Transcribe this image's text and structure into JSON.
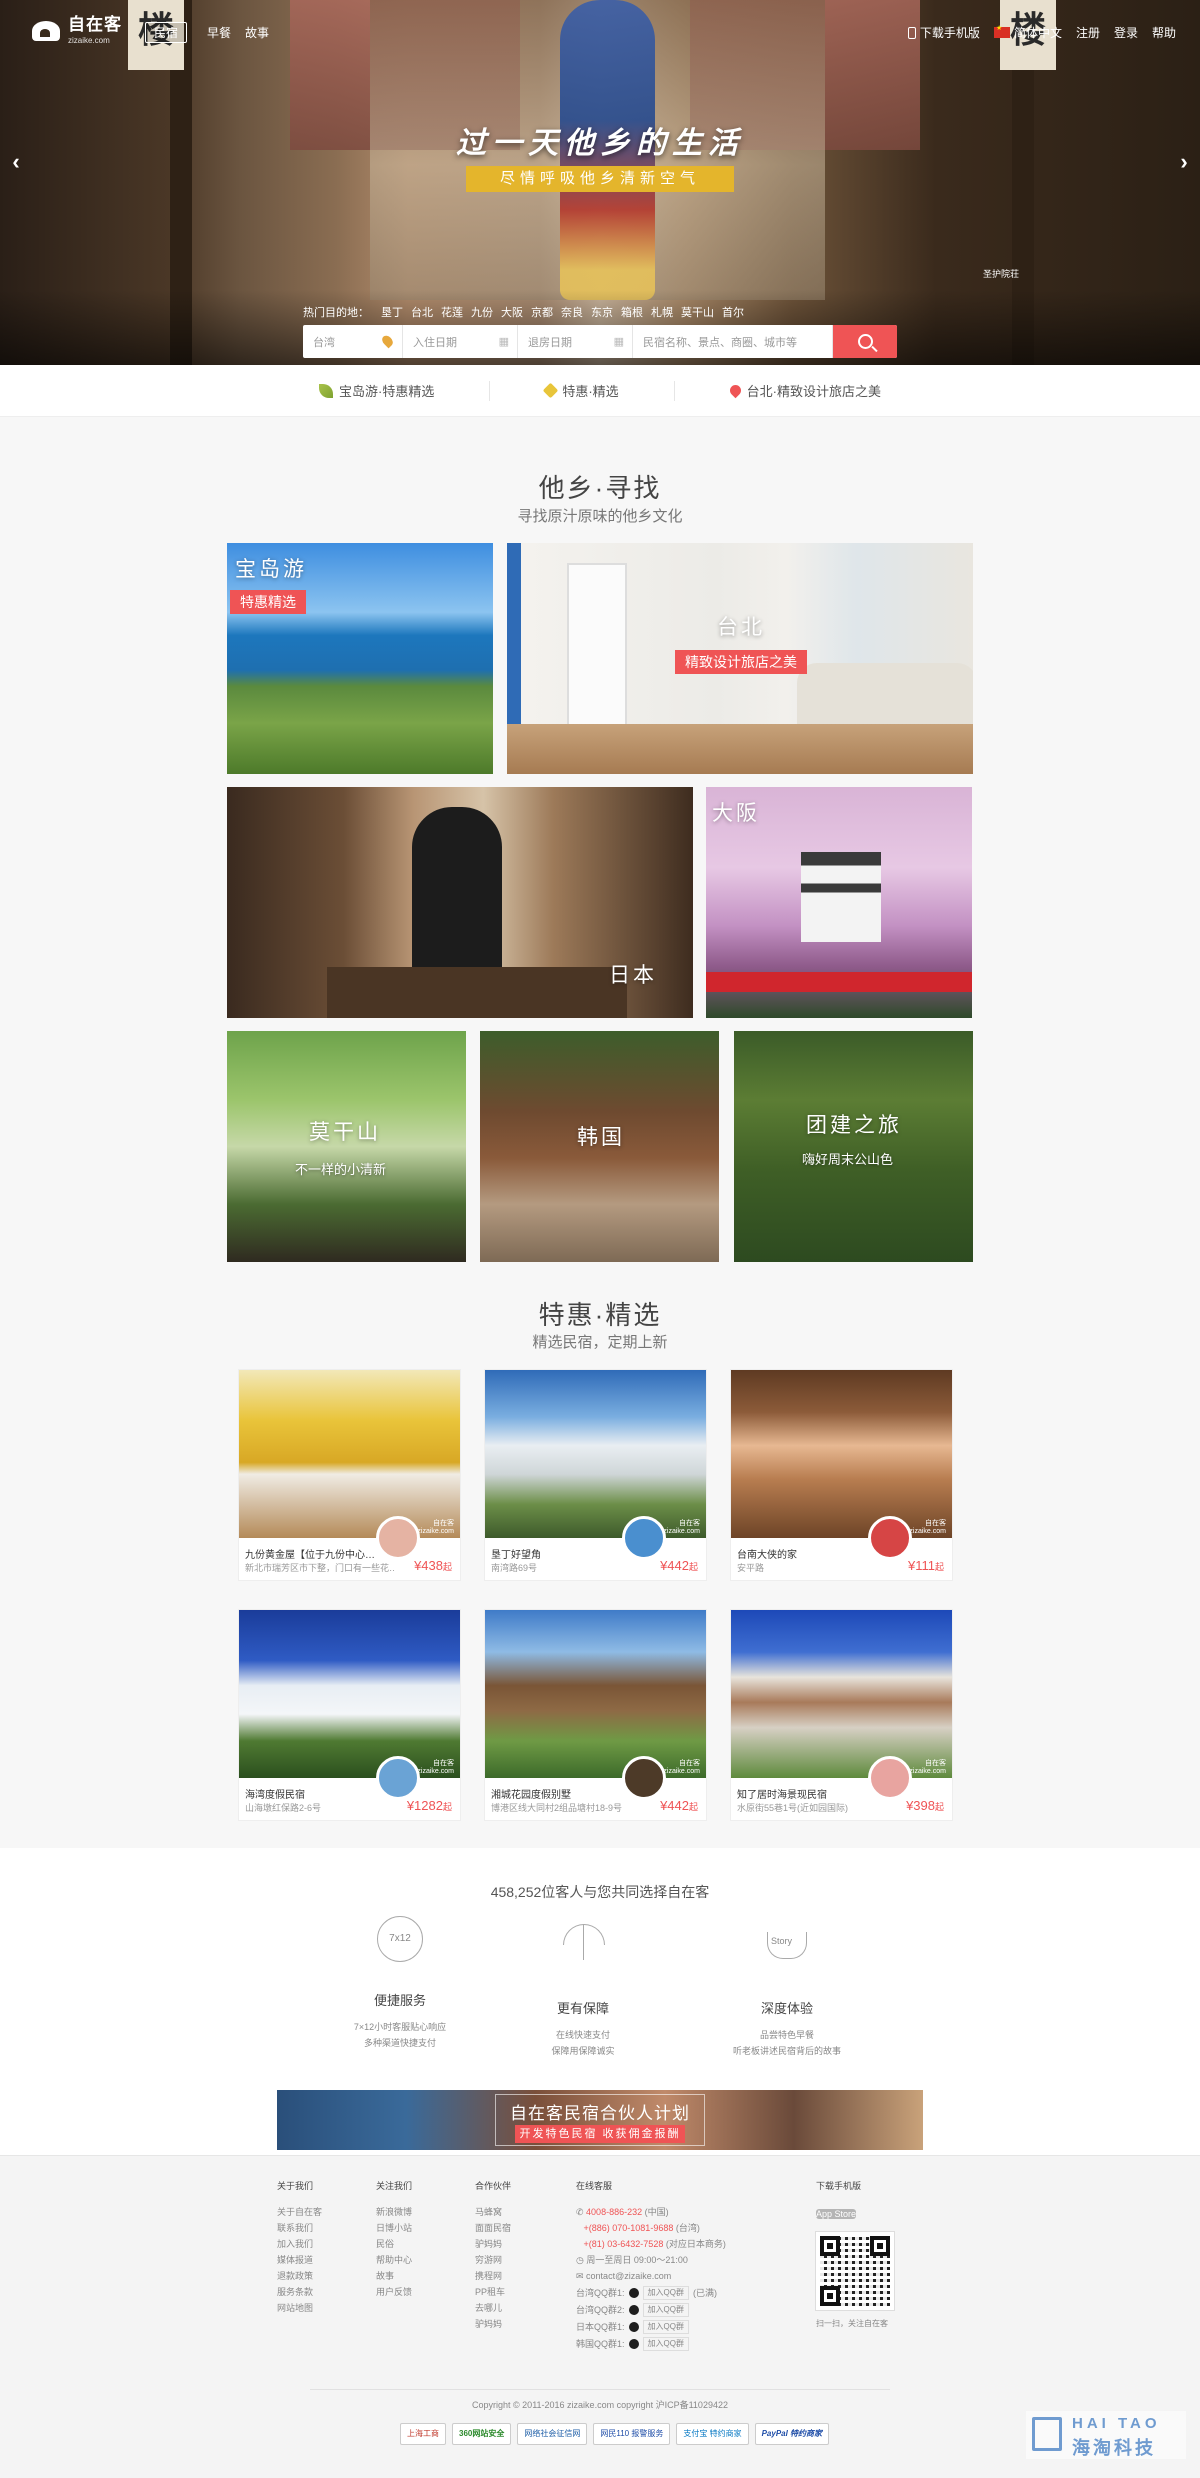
{
  "header": {
    "logo_cn": "自在客",
    "logo_en": "zizaike.com",
    "nav": [
      "民宿",
      "早餐",
      "故事"
    ],
    "right": {
      "download_app": "下载手机版",
      "language": "简体中文",
      "register": "注册",
      "login": "登录",
      "help": "帮助"
    }
  },
  "hero": {
    "slogan": "过一天他乡的生活",
    "subslogan": "尽情呼吸他乡清新空气",
    "caption": "圣护院荘",
    "hot_label": "热门目的地：",
    "hot_destinations": [
      "垦丁",
      "台北",
      "花莲",
      "九份",
      "大阪",
      "京都",
      "奈良",
      "东京",
      "箱根",
      "札幌",
      "莫干山",
      "首尔"
    ],
    "search": {
      "city": "台湾",
      "checkin_placeholder": "入住日期",
      "checkout_placeholder": "退房日期",
      "keyword_placeholder": "民宿名称、景点、商圈、城市等"
    }
  },
  "promo_bar": [
    "宝岛游·特惠精选",
    "特惠·精选",
    "台北·精致设计旅店之美"
  ],
  "section_find": {
    "title": "他乡·寻找",
    "subtitle": "寻找原汁原味的他乡文化"
  },
  "tiles": {
    "baodao": {
      "name": "宝岛游",
      "tag": "特惠精选"
    },
    "taibei": {
      "name": "台北",
      "tag": "精致设计旅店之美"
    },
    "riben": {
      "name": "日本"
    },
    "daban": {
      "name": "大阪"
    },
    "mogan": {
      "name": "莫干山",
      "sub": "不一样的小清新"
    },
    "hanguo": {
      "name": "韩国"
    },
    "tuanjian": {
      "name": "团建之旅",
      "sub": "嗨好周末公山色"
    }
  },
  "section_deals": {
    "title": "特惠·精选",
    "subtitle": "精选民宿，定期上新"
  },
  "listings": [
    {
      "name": "九份黄金屋【位于九份中心…",
      "addr": "新北市瑞芳区市下整，门口有一些花…",
      "price": "¥438",
      "unit": "起"
    },
    {
      "name": "垦丁好望角",
      "addr": "南湾路69号",
      "price": "¥442",
      "unit": "起"
    },
    {
      "name": "台南大侠的家",
      "addr": "安平路",
      "price": "¥111",
      "unit": "起"
    },
    {
      "name": "海湾度假民宿",
      "addr": "山海墩红保路2-6号",
      "price": "¥1282",
      "unit": "起"
    },
    {
      "name": "湘城花园度假别墅",
      "addr": "博港区线大同村2组品塘村18-9号",
      "price": "¥442",
      "unit": "起"
    },
    {
      "name": "知了居时海景现民宿",
      "addr": "水原街55巷1号(近如园国际)",
      "price": "¥398",
      "unit": "起"
    }
  ],
  "watermark": {
    "line1": "自在客",
    "line2": "zizaike.com"
  },
  "features": {
    "count_text": "458,252位客人与您共同选择自在客",
    "items": [
      {
        "icon": "7x12",
        "title": "便捷服务",
        "desc1": "7×12小时客服贴心响应",
        "desc2": "多种渠道快捷支付"
      },
      {
        "icon": "umbrella-icon",
        "title": "更有保障",
        "desc1": "在线快速支付",
        "desc2": "保障用保障诚实"
      },
      {
        "icon": "Story",
        "title": "深度体验",
        "desc1": "品尝特色早餐",
        "desc2": "听老板讲述民宿背后的故事"
      }
    ]
  },
  "partner_banner": {
    "title": "自在客民宿合伙人计划",
    "button": "开发特色民宿 收获佣金报酬"
  },
  "footer": {
    "about": {
      "heading": "关于我们",
      "links": [
        "关于自在客",
        "联系我们",
        "加入我们",
        "媒体报道",
        "退款政策",
        "服务条款",
        "网站地图"
      ]
    },
    "follow": {
      "heading": "关注我们",
      "links": [
        "新浪微博",
        "日博小站",
        "民俗",
        "帮助中心",
        "故事",
        "用户反馈"
      ]
    },
    "partners": {
      "heading": "合作伙伴",
      "links": [
        "马蜂窝",
        "面面民宿",
        "驴妈妈",
        "穷游网",
        "携程网",
        "PP租车",
        "去哪儿",
        "驴妈妈"
      ]
    },
    "service": {
      "heading": "在线客服",
      "phone1": "4008-886-232",
      "phone1_note": "(中国)",
      "phone2": "+(886) 070-1081-9688",
      "phone2_note": "(台湾)",
      "phone3": "+(81) 03-6432-7528",
      "phone3_note": "(对应日本商务)",
      "hours": "周一至周日 09:00～21:00",
      "email": "contact@zizaike.com",
      "qq": [
        {
          "label": "台湾QQ群1:",
          "btn": "加入QQ群",
          "note": "(已满)"
        },
        {
          "label": "台湾QQ群2:",
          "btn": "加入QQ群",
          "note": ""
        },
        {
          "label": "日本QQ群1:",
          "btn": "加入QQ群",
          "note": ""
        },
        {
          "label": "韩国QQ群1:",
          "btn": "加入QQ群",
          "note": ""
        }
      ]
    },
    "app": {
      "heading": "下载手机版",
      "appstore": "App Store",
      "qr_caption": "扫一扫，关注自在客"
    },
    "copyright": "Copyright © 2011-2016 zizaike.com copyright 沪ICP备11029422",
    "badges": [
      "上海工商",
      "360网站安全",
      "网络社会征信网",
      "网民110 报警服务",
      "支付宝 特约商家",
      "PayPal 特约商家"
    ],
    "haitao_en": "HAI TAO",
    "haitao_cn": "海淘科技"
  },
  "colors": {
    "accent": "#ef5455",
    "gold": "#e4b52c"
  }
}
